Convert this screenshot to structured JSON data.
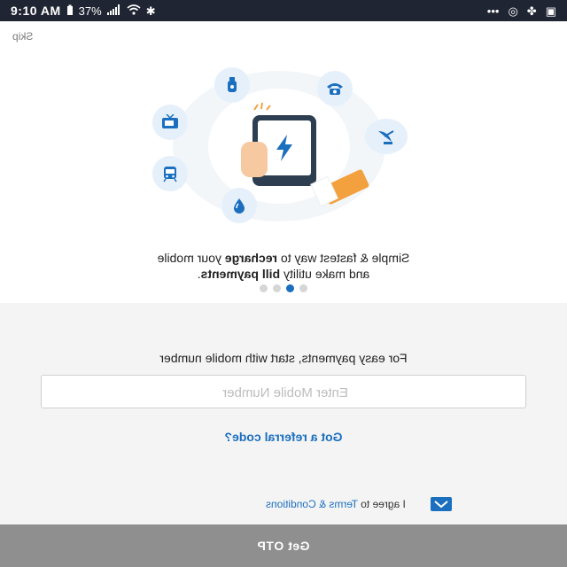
{
  "status_bar": {
    "time": "9:10 AM",
    "battery": "37%",
    "icons": [
      "battery-icon",
      "signal-icon",
      "wifi-icon",
      "bluetooth-icon",
      "overflow-icon",
      "sync-icon",
      "fan-icon",
      "image-icon"
    ]
  },
  "header": {
    "skip_label": "Skip"
  },
  "onboarding": {
    "caption_parts": [
      "Simple & fastest way to ",
      "recharge",
      " your mobile"
    ],
    "caption_line2": [
      "and make utility ",
      "bill payments",
      "."
    ],
    "pages": 4,
    "active_page": 3,
    "illustration_icons": [
      "gas-cylinder-icon",
      "telephone-icon",
      "satellite-dish-icon",
      "water-drop-icon",
      "train-icon",
      "tv-icon",
      "phone-recharge-icon"
    ]
  },
  "login": {
    "prompt": "For easy payments, start with mobile number",
    "mobile_placeholder": "Enter Mobile Number",
    "mobile_value": "",
    "referral_label": "Got a referral code?",
    "terms_prefix": "I agree to ",
    "terms_link": "Terms & Conditions",
    "terms_checked": true,
    "otp_button": "Get OTP"
  },
  "colors": {
    "accent": "#1b6fbf",
    "status_bar": "#1f2532",
    "button_disabled": "#8f8f8f"
  }
}
